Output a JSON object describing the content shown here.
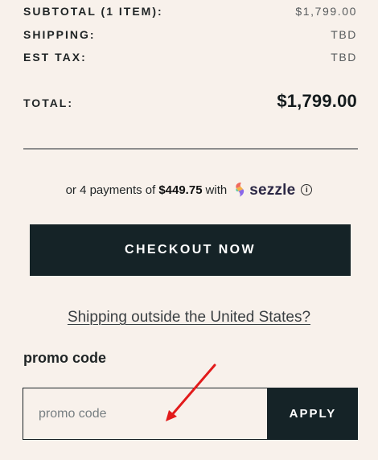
{
  "summary": {
    "subtotal_label": "SUBTOTAL (1 ITEM):",
    "subtotal_value": "$1,799.00",
    "shipping_label": "SHIPPING:",
    "shipping_value": "TBD",
    "tax_label": "EST TAX:",
    "tax_value": "TBD",
    "total_label": "TOTAL:",
    "total_value": "$1,799.00"
  },
  "installments": {
    "prefix": "or 4 payments of",
    "amount": "$449.75",
    "suffix": "with",
    "provider": "sezzle",
    "info_icon": "info-icon"
  },
  "checkout": {
    "button_label": "CHECKOUT NOW"
  },
  "shipping_link": {
    "label": "Shipping outside the United States?"
  },
  "promo": {
    "title": "promo code",
    "input_value": "",
    "placeholder": "promo code",
    "apply_label": "APPLY"
  },
  "colors": {
    "background": "#f8f1eb",
    "primary_dark": "#152327",
    "arrow_annotation": "#e21b1b"
  }
}
